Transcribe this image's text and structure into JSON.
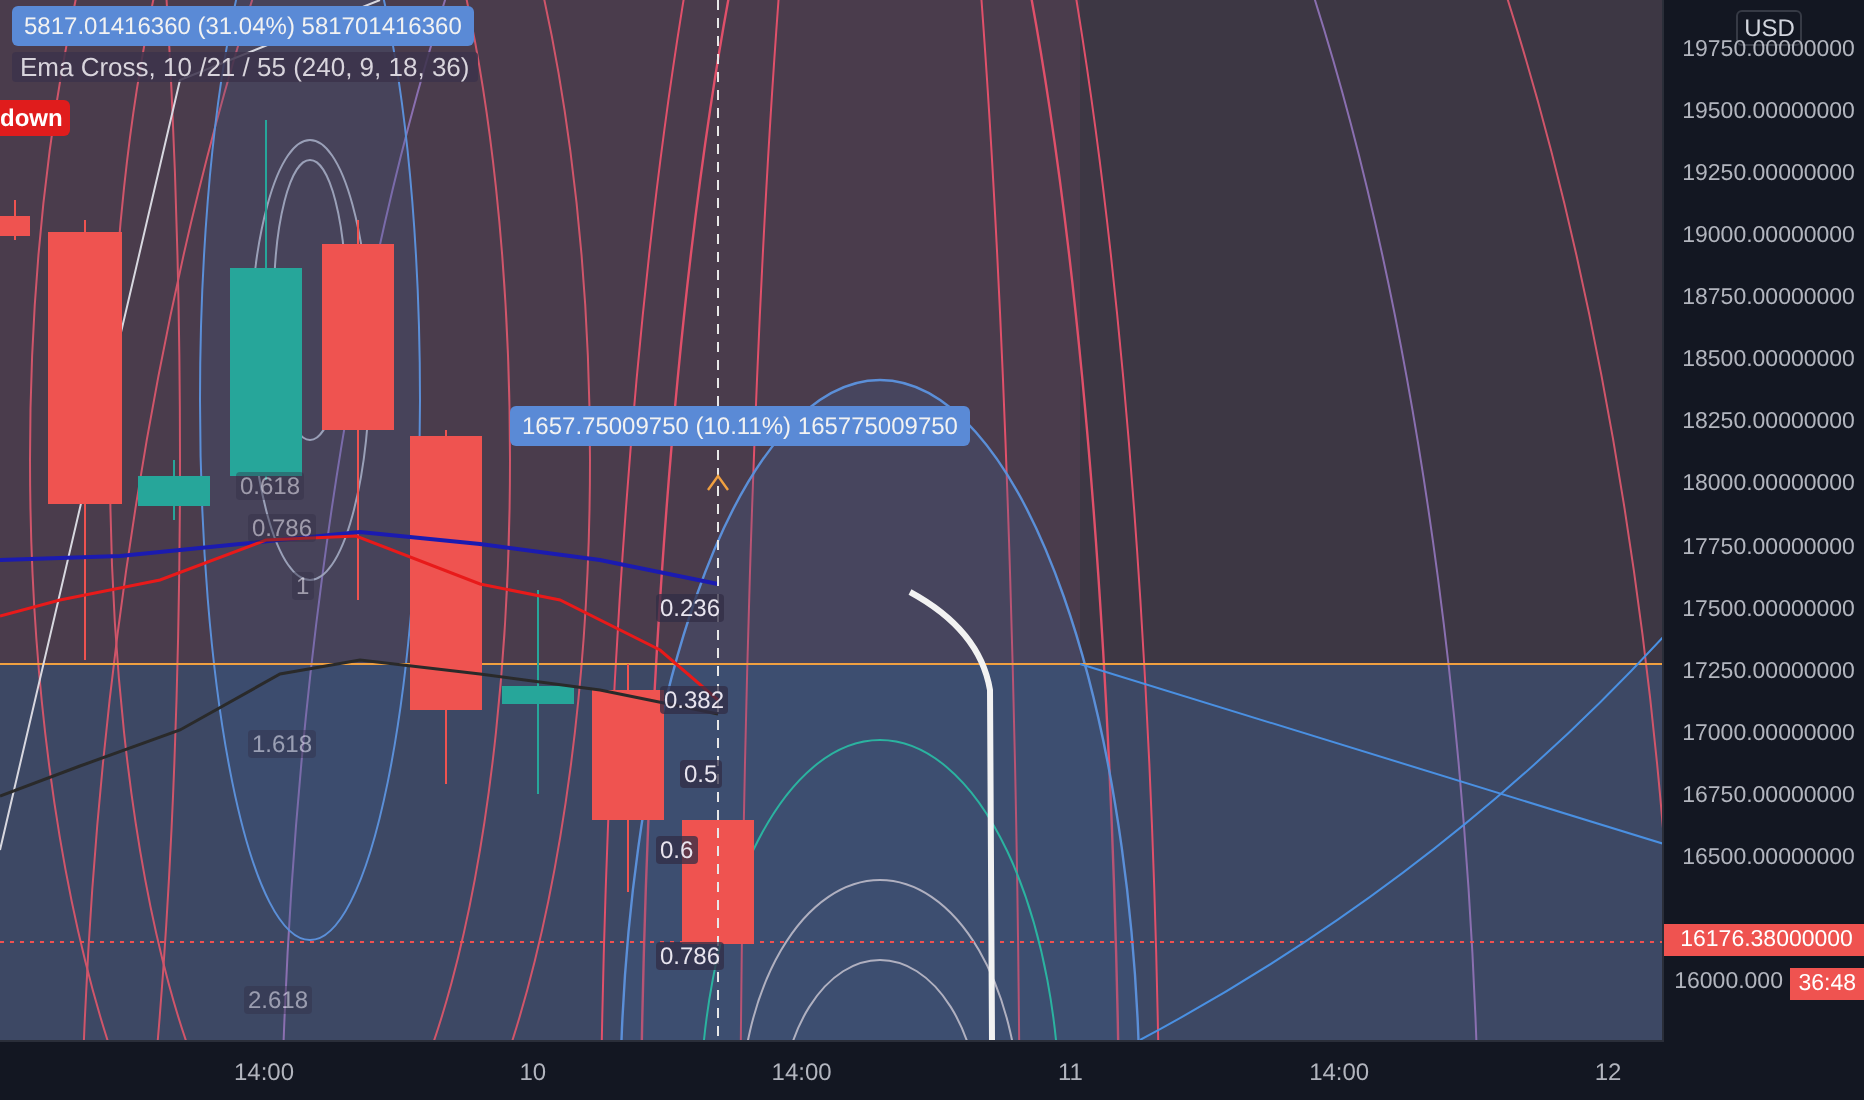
{
  "legend": {
    "measure": "5817.01416360 (31.04%) 581701416360",
    "indicator": "Ema Cross, 10 /21 / 55 (240, 9, 18, 36)"
  },
  "signal_badge": "down",
  "measure_label": "1657.75009750 (10.11%) 165775009750",
  "fib_labels": [
    "0.618",
    "0.786",
    "1",
    "1.618",
    "2.618",
    "0.236",
    "0.382",
    "0.5",
    "0.6",
    "0.786"
  ],
  "price_axis": {
    "currency": "USD",
    "labels": [
      "19750.00000000",
      "19500.00000000",
      "19250.00000000",
      "19000.00000000",
      "18750.00000000",
      "18500.00000000",
      "18250.00000000",
      "18000.00000000",
      "17750.00000000",
      "17500.00000000",
      "17250.00000000",
      "17000.00000000",
      "16750.00000000",
      "16500.00000000"
    ],
    "bottom_label": "16000.000",
    "current_price": "16176.38000000",
    "countdown": "36:48"
  },
  "time_axis": {
    "labels": [
      "14:00",
      "10",
      "14:00",
      "11",
      "14:00",
      "12"
    ]
  }
}
